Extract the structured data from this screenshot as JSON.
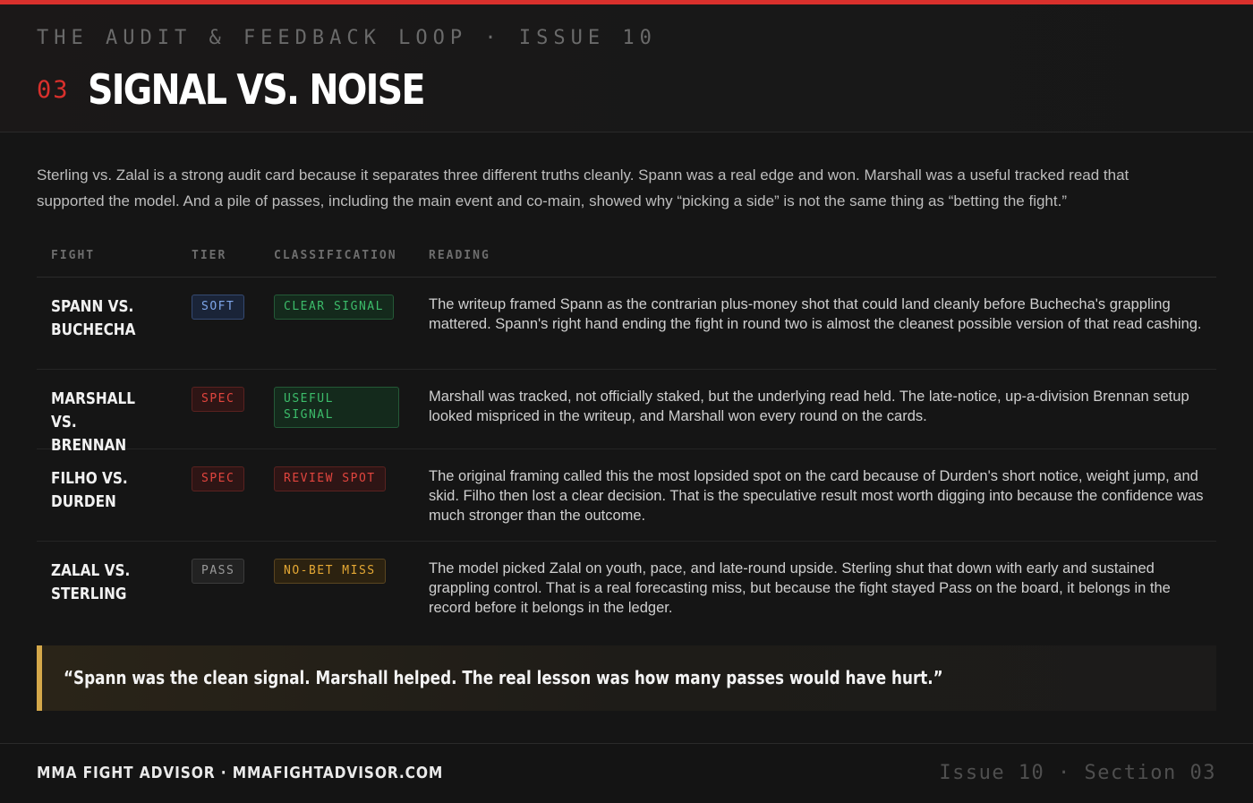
{
  "header": {
    "kicker": "THE AUDIT & FEEDBACK LOOP · ISSUE 10",
    "section_number": "03",
    "title": "SIGNAL VS. NOISE"
  },
  "intro": "Sterling vs. Zalal is a strong audit card because it separates three different truths cleanly. Spann was a real edge and won. Marshall was a useful tracked read that supported the model. And a pile of passes, including the main event and co-main, showed why “picking a side” is not the same thing as “betting the fight.”",
  "table": {
    "columns": [
      "FIGHT",
      "TIER",
      "CLASSIFICATION",
      "READING"
    ],
    "rows": [
      {
        "fight": "SPANN VS. BUCHECHA",
        "tier": "SOFT",
        "classification": "CLEAR SIGNAL",
        "reading": "The writeup framed Spann as the contrarian plus-money shot that could land cleanly before Buchecha's grappling mattered. Spann's right hand ending the fight in round two is almost the cleanest possible version of that read cashing."
      },
      {
        "fight": "MARSHALL VS. BRENNAN",
        "tier": "SPEC",
        "classification": "USEFUL SIGNAL",
        "reading": "Marshall was tracked, not officially staked, but the underlying read held. The late-notice, up-a-division Brennan setup looked mispriced in the writeup, and Marshall won every round on the cards."
      },
      {
        "fight": "FILHO VS. DURDEN",
        "tier": "SPEC",
        "classification": "REVIEW SPOT",
        "reading": "The original framing called this the most lopsided spot on the card because of Durden's short notice, weight jump, and skid. Filho then lost a clear decision. That is the speculative result most worth digging into because the confidence was much stronger than the outcome."
      },
      {
        "fight": "ZALAL VS. STERLING",
        "tier": "PASS",
        "classification": "NO-BET MISS",
        "reading": "The model picked Zalal on youth, pace, and late-round upside. Sterling shut that down with early and sustained grappling control. That is a real forecasting miss, but because the fight stayed Pass on the board, it belongs in the record before it belongs in the ledger."
      }
    ]
  },
  "quote": "“Spann was the clean signal. Marshall helped. The real lesson was how many passes would have hurt.”",
  "footer": {
    "brand": "MMA FIGHT ADVISOR · MMAFIGHTADVISOR.COM",
    "issue": "Issue 10 · Section 03"
  },
  "colors": {
    "accent_red": "#d9302c",
    "quote_bar": "#d4a84a",
    "soft_blue": "#7fa6ea",
    "signal_green": "#3cbc6a",
    "nobet_amber": "#e5a834"
  }
}
